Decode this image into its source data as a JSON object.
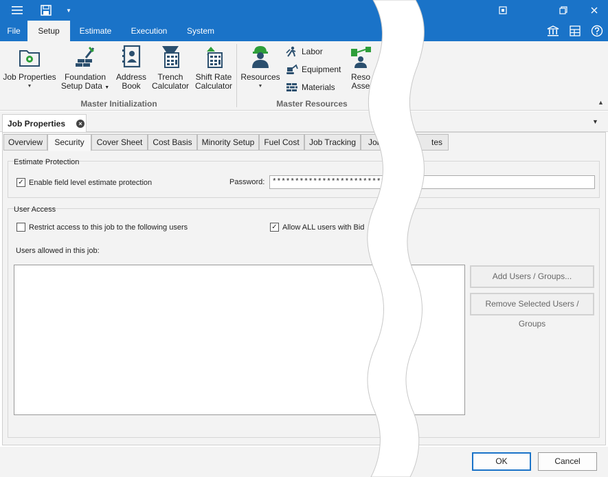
{
  "menu": {
    "tabs": [
      "File",
      "Setup",
      "Estimate",
      "Execution",
      "System"
    ],
    "active": "Setup"
  },
  "ribbon": {
    "buttons": {
      "job_properties": [
        "Job Properties",
        ""
      ],
      "foundation_setup": [
        "Foundation",
        "Setup Data"
      ],
      "address_book": [
        "Address",
        "Book"
      ],
      "trench_calculator": [
        "Trench",
        "Calculator"
      ],
      "shift_rate": [
        "Shift Rate",
        "Calculator"
      ],
      "resources": [
        "Resources",
        ""
      ],
      "resource_assemblies": [
        "Reso",
        "Asse"
      ]
    },
    "small_buttons": {
      "labor": "Labor",
      "equipment": "Equipment",
      "materials": "Materials"
    },
    "groups": {
      "master_initialization": "Master Initialization",
      "master_resources": "Master Resources"
    }
  },
  "document": {
    "tab_title": "Job Properties"
  },
  "property_tabs": [
    "Overview",
    "Security",
    "Cover Sheet",
    "Cost Basis",
    "Minority Setup",
    "Fuel Cost",
    "Job Tracking",
    "Job",
    "tes"
  ],
  "active_tab": "Security",
  "security": {
    "estimate_protection": {
      "title": "Estimate Protection",
      "enable_label": "Enable field level estimate protection",
      "enable_checked": true,
      "password_label": "Password:",
      "password_value": "********************************"
    },
    "user_access": {
      "title": "User Access",
      "restrict_label": "Restrict access to this job to the following users",
      "restrict_checked": false,
      "allow_all_label": "Allow ALL users with Bid",
      "allow_all_checked": true,
      "users_allowed_label": "Users allowed in this job:",
      "add_button": "Add Users / Groups...",
      "remove_button": "Remove Selected Users / Groups"
    }
  },
  "dialog": {
    "ok": "OK",
    "cancel": "Cancel"
  },
  "colors": {
    "accent": "#1a73c8",
    "icon_navy": "#2b4f6e",
    "icon_green": "#2e9e3a"
  }
}
